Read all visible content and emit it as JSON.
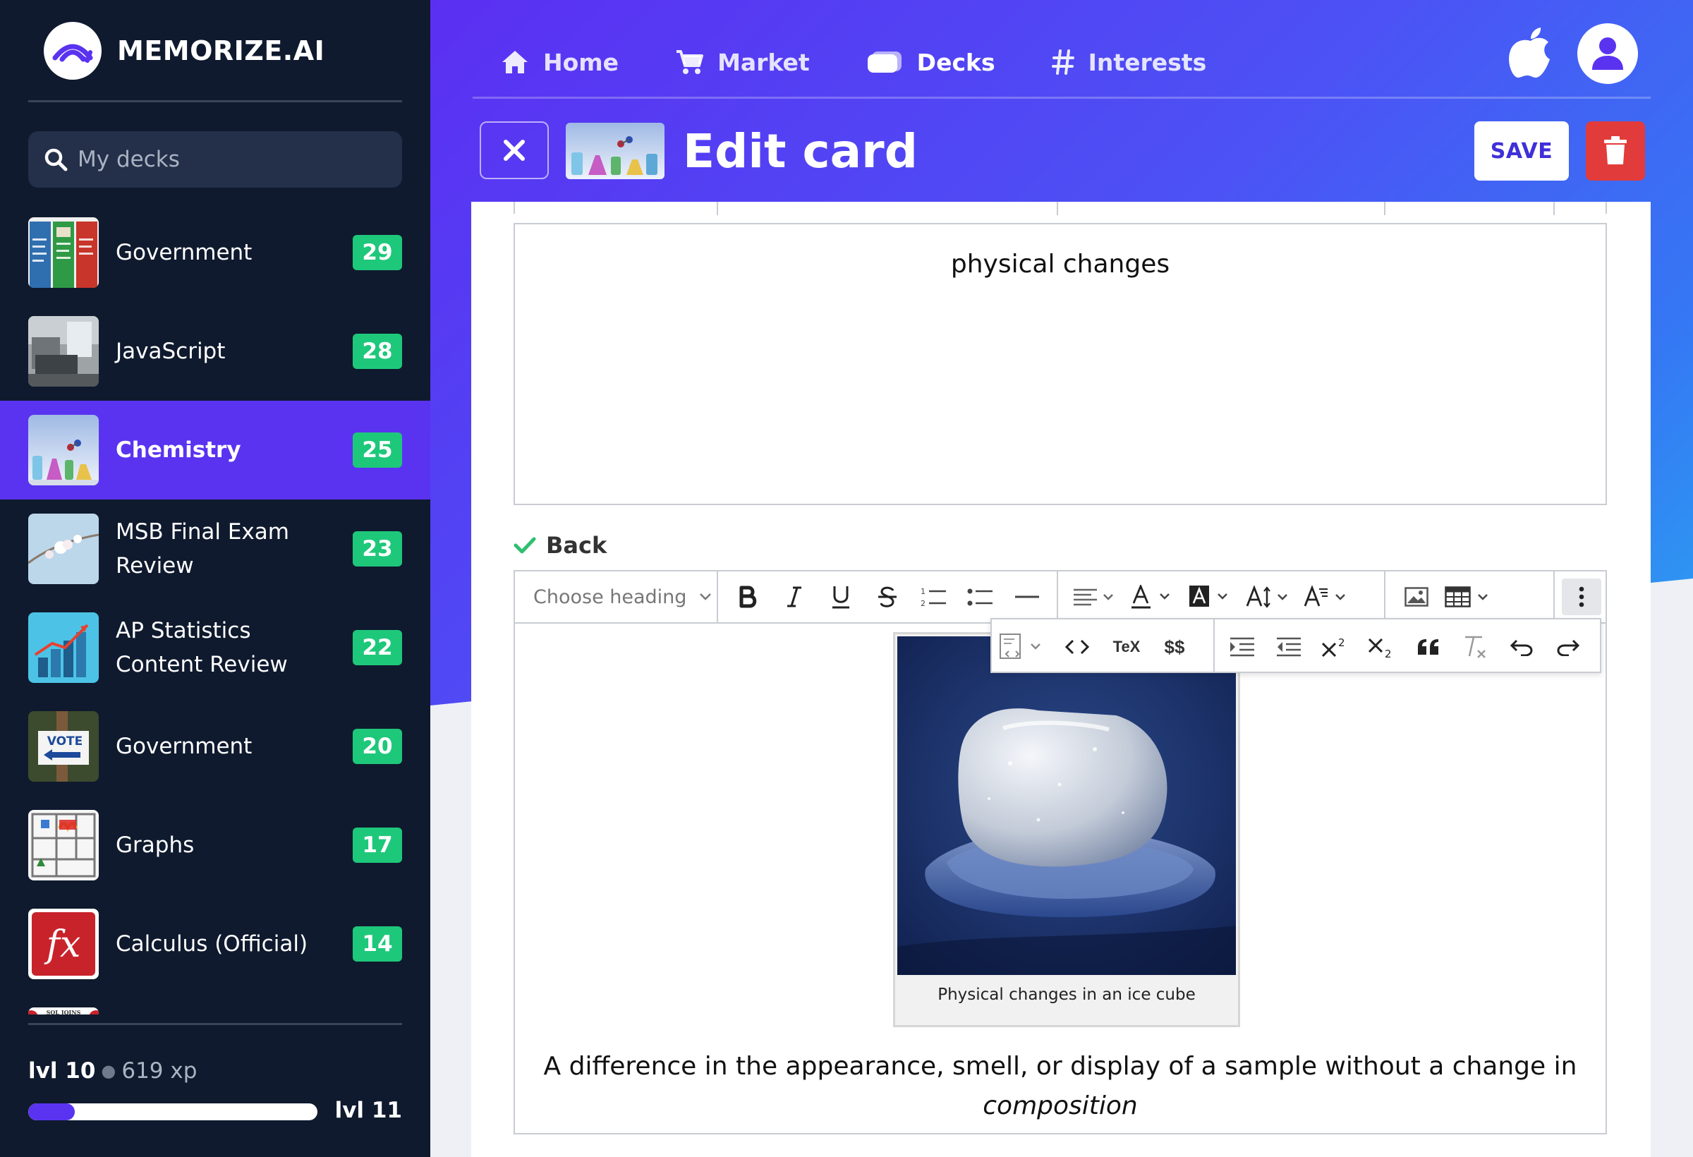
{
  "brand": {
    "name": "MEMORIZE.AI"
  },
  "sidebar": {
    "search": {
      "placeholder": "My decks"
    },
    "decks": [
      {
        "name": "Government",
        "count": "29",
        "active": false
      },
      {
        "name": "JavaScript",
        "count": "28",
        "active": false
      },
      {
        "name": "Chemistry",
        "count": "25",
        "active": true
      },
      {
        "name": "MSB Final Exam Review",
        "count": "23",
        "active": false
      },
      {
        "name": "AP Statistics Content Review",
        "count": "22",
        "active": false
      },
      {
        "name": "Government",
        "count": "20",
        "active": false
      },
      {
        "name": "Graphs",
        "count": "17",
        "active": false
      },
      {
        "name": "Calculus (Official)",
        "count": "14",
        "active": false
      }
    ],
    "thumb_texts": {
      "vote": "VOTE",
      "fx": "fx",
      "sql": "SQL JOINS"
    },
    "level": {
      "current": "lvl 10",
      "xp": "619 xp",
      "next": "lvl 11",
      "progress_fraction": 0.16
    }
  },
  "nav": {
    "items": [
      {
        "label": "Home",
        "icon": "home-icon"
      },
      {
        "label": "Market",
        "icon": "cart-icon"
      },
      {
        "label": "Decks",
        "icon": "decks-icon",
        "active": true
      },
      {
        "label": "Interests",
        "icon": "hash-icon"
      }
    ]
  },
  "header": {
    "title": "Edit card",
    "save_label": "SAVE"
  },
  "editor": {
    "front_text": "physical changes",
    "back_label": "Back",
    "heading_placeholder": "Choose heading",
    "overflow": {
      "tex_label": "TeX",
      "math_label": "$$"
    },
    "figure_caption": "Physical changes in an ice cube",
    "back_text_plain": "A difference in the appearance, smell, or display of a sample without a change in",
    "back_text_italic": "composition"
  },
  "colors": {
    "accent": "#5a33f0",
    "badge": "#1ec87a",
    "sidebar_bg": "#0f1a2e",
    "delete": "#e23b3b"
  }
}
